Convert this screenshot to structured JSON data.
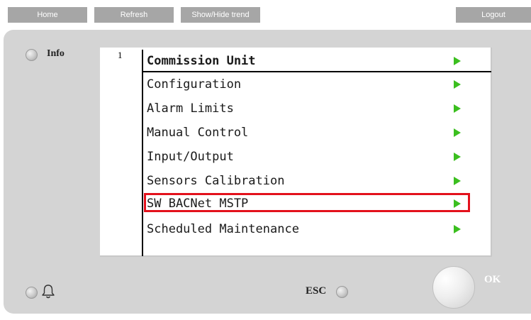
{
  "toolbar": {
    "home_label": "Home",
    "refresh_label": "Refresh",
    "trend_label": "Show/Hide trend",
    "logout_label": "Logout"
  },
  "panel": {
    "info_label": "Info",
    "esc_label": "ESC",
    "ok_label": "OK",
    "alarm_icon": "bell-icon"
  },
  "screen": {
    "page_number": "1",
    "title": "Commission Unit",
    "items": [
      {
        "label": "Configuration"
      },
      {
        "label": "Alarm Limits"
      },
      {
        "label": "Manual Control"
      },
      {
        "label": "Input/Output"
      },
      {
        "label": "Sensors Calibration"
      },
      {
        "label": "SW BACNet MSTP",
        "highlighted": true
      },
      {
        "label": "Scheduled Maintenance"
      }
    ]
  },
  "colors": {
    "arrow": "#3bbf1f",
    "highlight": "#e3111c",
    "button": "#a6a6a6",
    "panel": "#d4d4d4"
  }
}
